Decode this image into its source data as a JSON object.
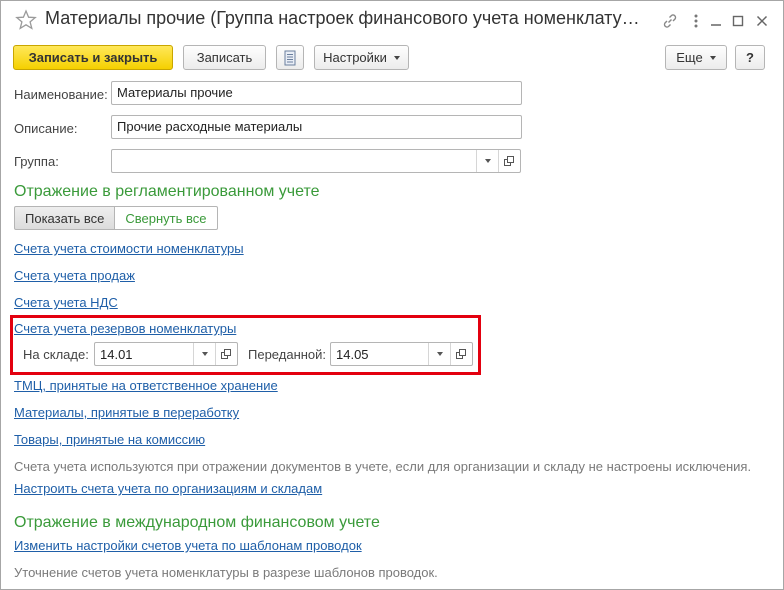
{
  "window": {
    "title": "Материалы прочие (Группа настроек финансового учета номенклатуры)",
    "icons": [
      "star-icon",
      "link-icon",
      "more-vertical-icon",
      "minimize-icon",
      "maximize-icon",
      "close-icon"
    ]
  },
  "toolbar": {
    "save_close_label": "Записать и закрыть",
    "save_label": "Записать",
    "report_icon": "list-document-icon",
    "settings_label": "Настройки",
    "more_label": "Еще",
    "help_label": "?"
  },
  "form": {
    "name_label": "Наименование:",
    "name_value": "Материалы прочие",
    "description_label": "Описание:",
    "description_value": "Прочие расходные материалы",
    "group_label": "Группа:",
    "group_value": ""
  },
  "regulated": {
    "title": "Отражение в регламентированном учете",
    "show_all_label": "Показать все",
    "collapse_all_label": "Свернуть все",
    "links": {
      "cost_accounts": "Счета учета стоимости номенклатуры",
      "sales_accounts": "Счета учета продаж",
      "vat_accounts": "Счета учета НДС",
      "reserve_accounts": "Счета учета резервов номенклатуры",
      "custody": "ТМЦ, принятые на ответственное хранение",
      "processing": "Материалы, принятые в переработку",
      "commission": "Товары, принятые на комиссию"
    },
    "reserve": {
      "warehouse_label": "На складе:",
      "warehouse_value": "14.01",
      "transferred_label": "Переданной:",
      "transferred_value": "14.05"
    },
    "note": "Счета учета используются при отражении документов в учете, если для организации и складу не настроены исключения.",
    "configure_link": "Настроить счета учета по организациям и складам"
  },
  "international": {
    "title": "Отражение в международном финансовом учете",
    "change_link": "Изменить настройки счетов учета по шаблонам проводок",
    "note": "Уточнение счетов учета номенклатуры в разрезе шаблонов проводок."
  },
  "colors": {
    "accent_green": "#3a9a3a",
    "link_blue": "#1f5fa8",
    "primary_yellow": "#f5d000",
    "highlight_red": "#e3000f"
  }
}
